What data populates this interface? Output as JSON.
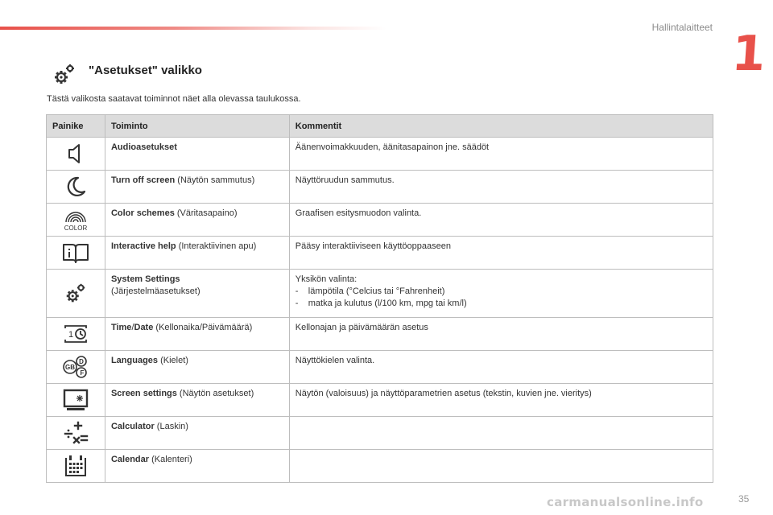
{
  "header": {
    "chapter_title": "Hallintalaitteet",
    "chapter_number": "1",
    "accent_color": "#e8514a"
  },
  "section": {
    "icon": "gears-icon",
    "title": "\"Asetukset\" valikko",
    "intro": "Tästä valikosta saatavat toiminnot näet alla olevassa taulukossa."
  },
  "table": {
    "headers": [
      "Painike",
      "Toiminto",
      "Kommentit"
    ],
    "rows": [
      {
        "icon": "speaker-icon",
        "name": "Audioasetukset",
        "desc": "",
        "comment": "Äänenvoimakkuuden, äänitasapainon jne. säädöt"
      },
      {
        "icon": "moon-icon",
        "name": "Turn off screen",
        "desc": " (Näytön sammutus)",
        "comment": "Näyttöruudun sammutus."
      },
      {
        "icon": "color-icon",
        "icon_label": "COLOR",
        "name": "Color schemes",
        "desc": " (Väritasapaino)",
        "comment": "Graafisen esitysmuodon valinta."
      },
      {
        "icon": "book-icon",
        "name": "Interactive help",
        "desc": " (Interaktiivinen apu)",
        "comment": "Pääsy interaktiiviseen käyttöoppaaseen"
      },
      {
        "icon": "gears-icon",
        "name": "System Settings",
        "desc": "(Järjestelmäasetukset)",
        "comment": "Yksikön valinta:",
        "bullets": [
          "lämpötila (°Celcius tai °Fahrenheit)",
          "matka ja kulutus (l/100 km, mpg tai km/l)"
        ]
      },
      {
        "icon": "clock-icon",
        "icon_label": "1",
        "name": "Time",
        "name_sep": "/",
        "name2": "Date",
        "desc": " (Kellonaika/Päivämäärä)",
        "comment": "Kellonajan ja päivämäärän asetus"
      },
      {
        "icon": "languages-icon",
        "icon_labels": [
          "D",
          "GB",
          "F"
        ],
        "name": "Languages",
        "desc": " (Kielet)",
        "comment": "Näyttökielen valinta."
      },
      {
        "icon": "screen-icon",
        "name": "Screen settings",
        "desc": " (Näytön asetukset)",
        "comment": "Näytön (valoisuus) ja näyttöparametrien asetus (tekstin, kuvien jne. vieritys)"
      },
      {
        "icon": "calculator-icon",
        "name": "Calculator",
        "desc": " (Laskin)",
        "comment": ""
      },
      {
        "icon": "calendar-icon",
        "name": "Calendar",
        "desc": " (Kalenteri)",
        "comment": ""
      }
    ]
  },
  "footer": {
    "page_number": "35",
    "watermark": "carmanualsonline.info"
  }
}
